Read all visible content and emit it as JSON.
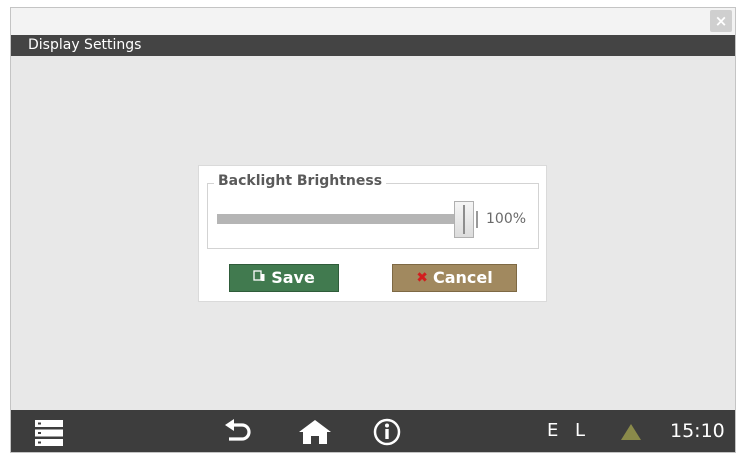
{
  "window": {
    "title": "Display Settings",
    "close_label": "×"
  },
  "dialog": {
    "legend": "Backlight Brightness",
    "brightness": {
      "value_label": "100%",
      "value": 100
    },
    "save_label": "Save",
    "cancel_label": "Cancel",
    "save_icon": "save-icon",
    "cancel_icon": "cancel-x-icon"
  },
  "taskbar": {
    "icons": [
      "menu-icon",
      "back-icon",
      "home-icon",
      "info-icon",
      "warning-icon"
    ],
    "status_e": "E",
    "status_l": "L",
    "clock": "15:10"
  },
  "colors": {
    "title_bar": "#444444",
    "save_button": "#417a4f",
    "cancel_button": "#a1895f",
    "taskbar": "#3d3d3d",
    "warning_icon": "#8a8a4a"
  }
}
